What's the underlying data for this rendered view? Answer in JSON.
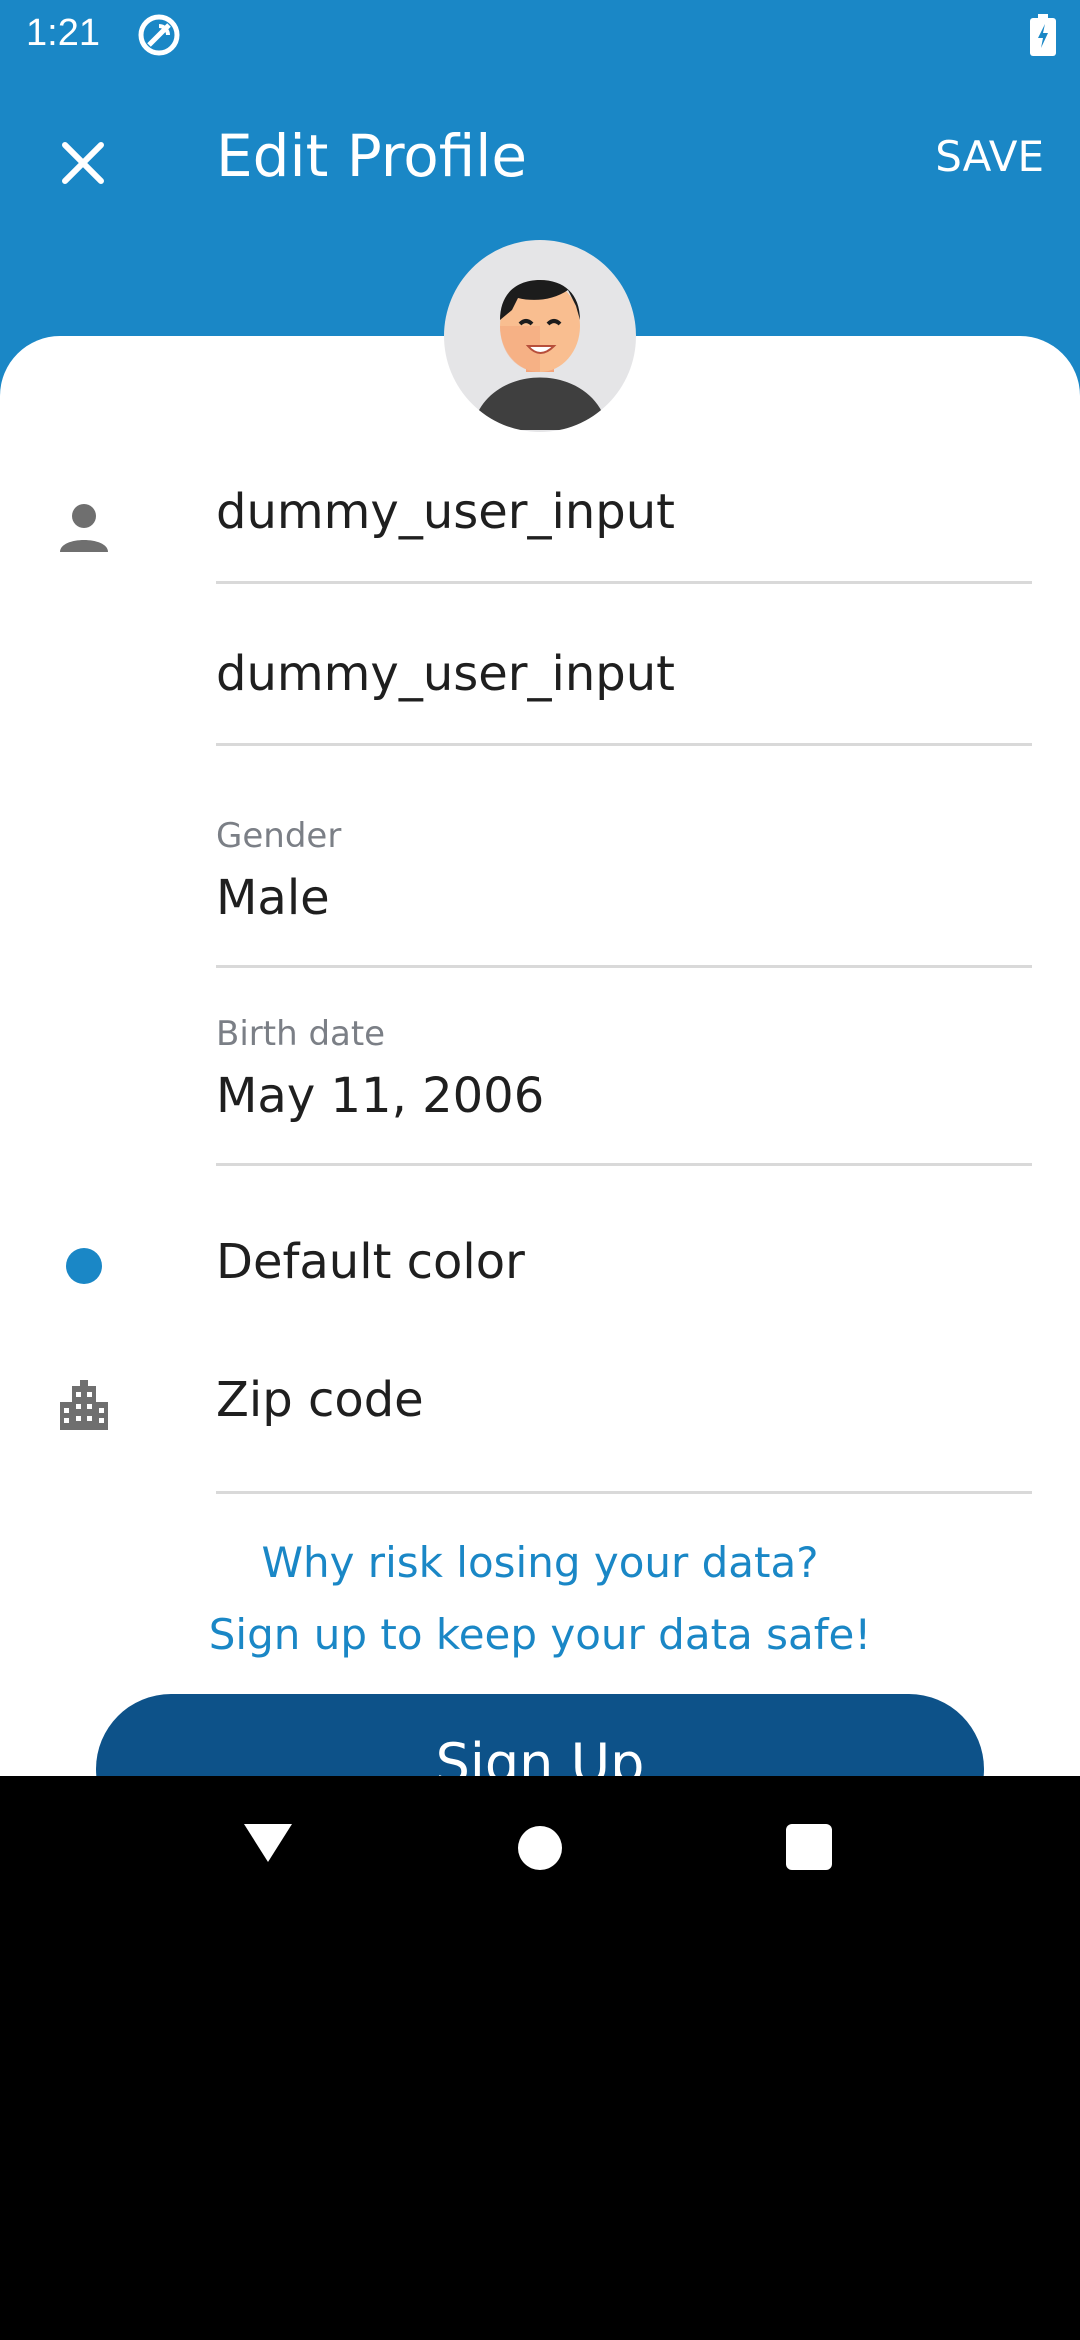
{
  "status_bar": {
    "time": "1:21"
  },
  "toolbar": {
    "title": "Edit Profile",
    "save_label": "SAVE"
  },
  "form": {
    "first_name_value": "dummy_user_input",
    "last_name_value": "dummy_user_input",
    "gender_label": "Gender",
    "gender_value": "Male",
    "birth_date_label": "Birth date",
    "birth_date_value": "May 11, 2006",
    "color_label": "Default color",
    "zip_placeholder": "Zip code"
  },
  "info": {
    "line1": "Why risk losing your data?",
    "line2": "Sign up to keep your data safe!"
  },
  "signup_label": "Sign Up",
  "colors": {
    "primary": "#1a87c6",
    "button": "#0d5289",
    "icon_gray": "#6f6f6f"
  }
}
